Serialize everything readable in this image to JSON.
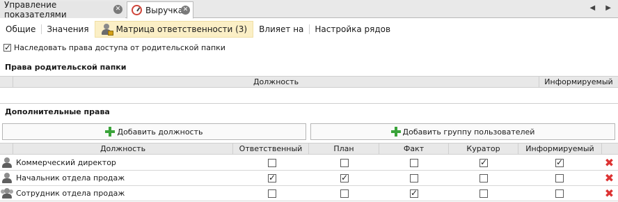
{
  "tabs": [
    {
      "label": "Управление показателями",
      "active": false
    },
    {
      "label": "Выручка",
      "active": true
    }
  ],
  "tab_close_glyph": "✕",
  "scroll_arrows": "◀ ▶",
  "subtabs": [
    {
      "label": "Общие"
    },
    {
      "label": "Значения"
    },
    {
      "label": "Матрица ответственности (3)",
      "active": true
    },
    {
      "label": "Влияет на"
    },
    {
      "label": "Настройка рядов"
    }
  ],
  "inherit": {
    "label": "Наследовать права доступа от родительской папки",
    "checked": true
  },
  "parent_section": {
    "title": "Права родительской папки",
    "columns": [
      "Должность",
      "Информируемый"
    ]
  },
  "extra_section": {
    "title": "Дополнительные права",
    "add_position_label": "Добавить должность",
    "add_group_label": "Добавить группу пользователей",
    "columns": [
      "Должность",
      "Ответственный",
      "План",
      "Факт",
      "Куратор",
      "Информируемый"
    ],
    "rows": [
      {
        "name": "Коммерческий директор",
        "icon": "user-icon",
        "values": [
          false,
          false,
          false,
          true,
          true
        ]
      },
      {
        "name": "Начальник отдела продаж",
        "icon": "user-icon",
        "values": [
          true,
          true,
          false,
          false,
          false
        ]
      },
      {
        "name": "Сотрудник отдела продаж",
        "icon": "user-group-icon",
        "values": [
          false,
          false,
          true,
          false,
          false
        ]
      }
    ]
  },
  "colors": {
    "accent_tab": "#fbefc6",
    "delete": "#dd3333",
    "add": "#3aa33a"
  }
}
